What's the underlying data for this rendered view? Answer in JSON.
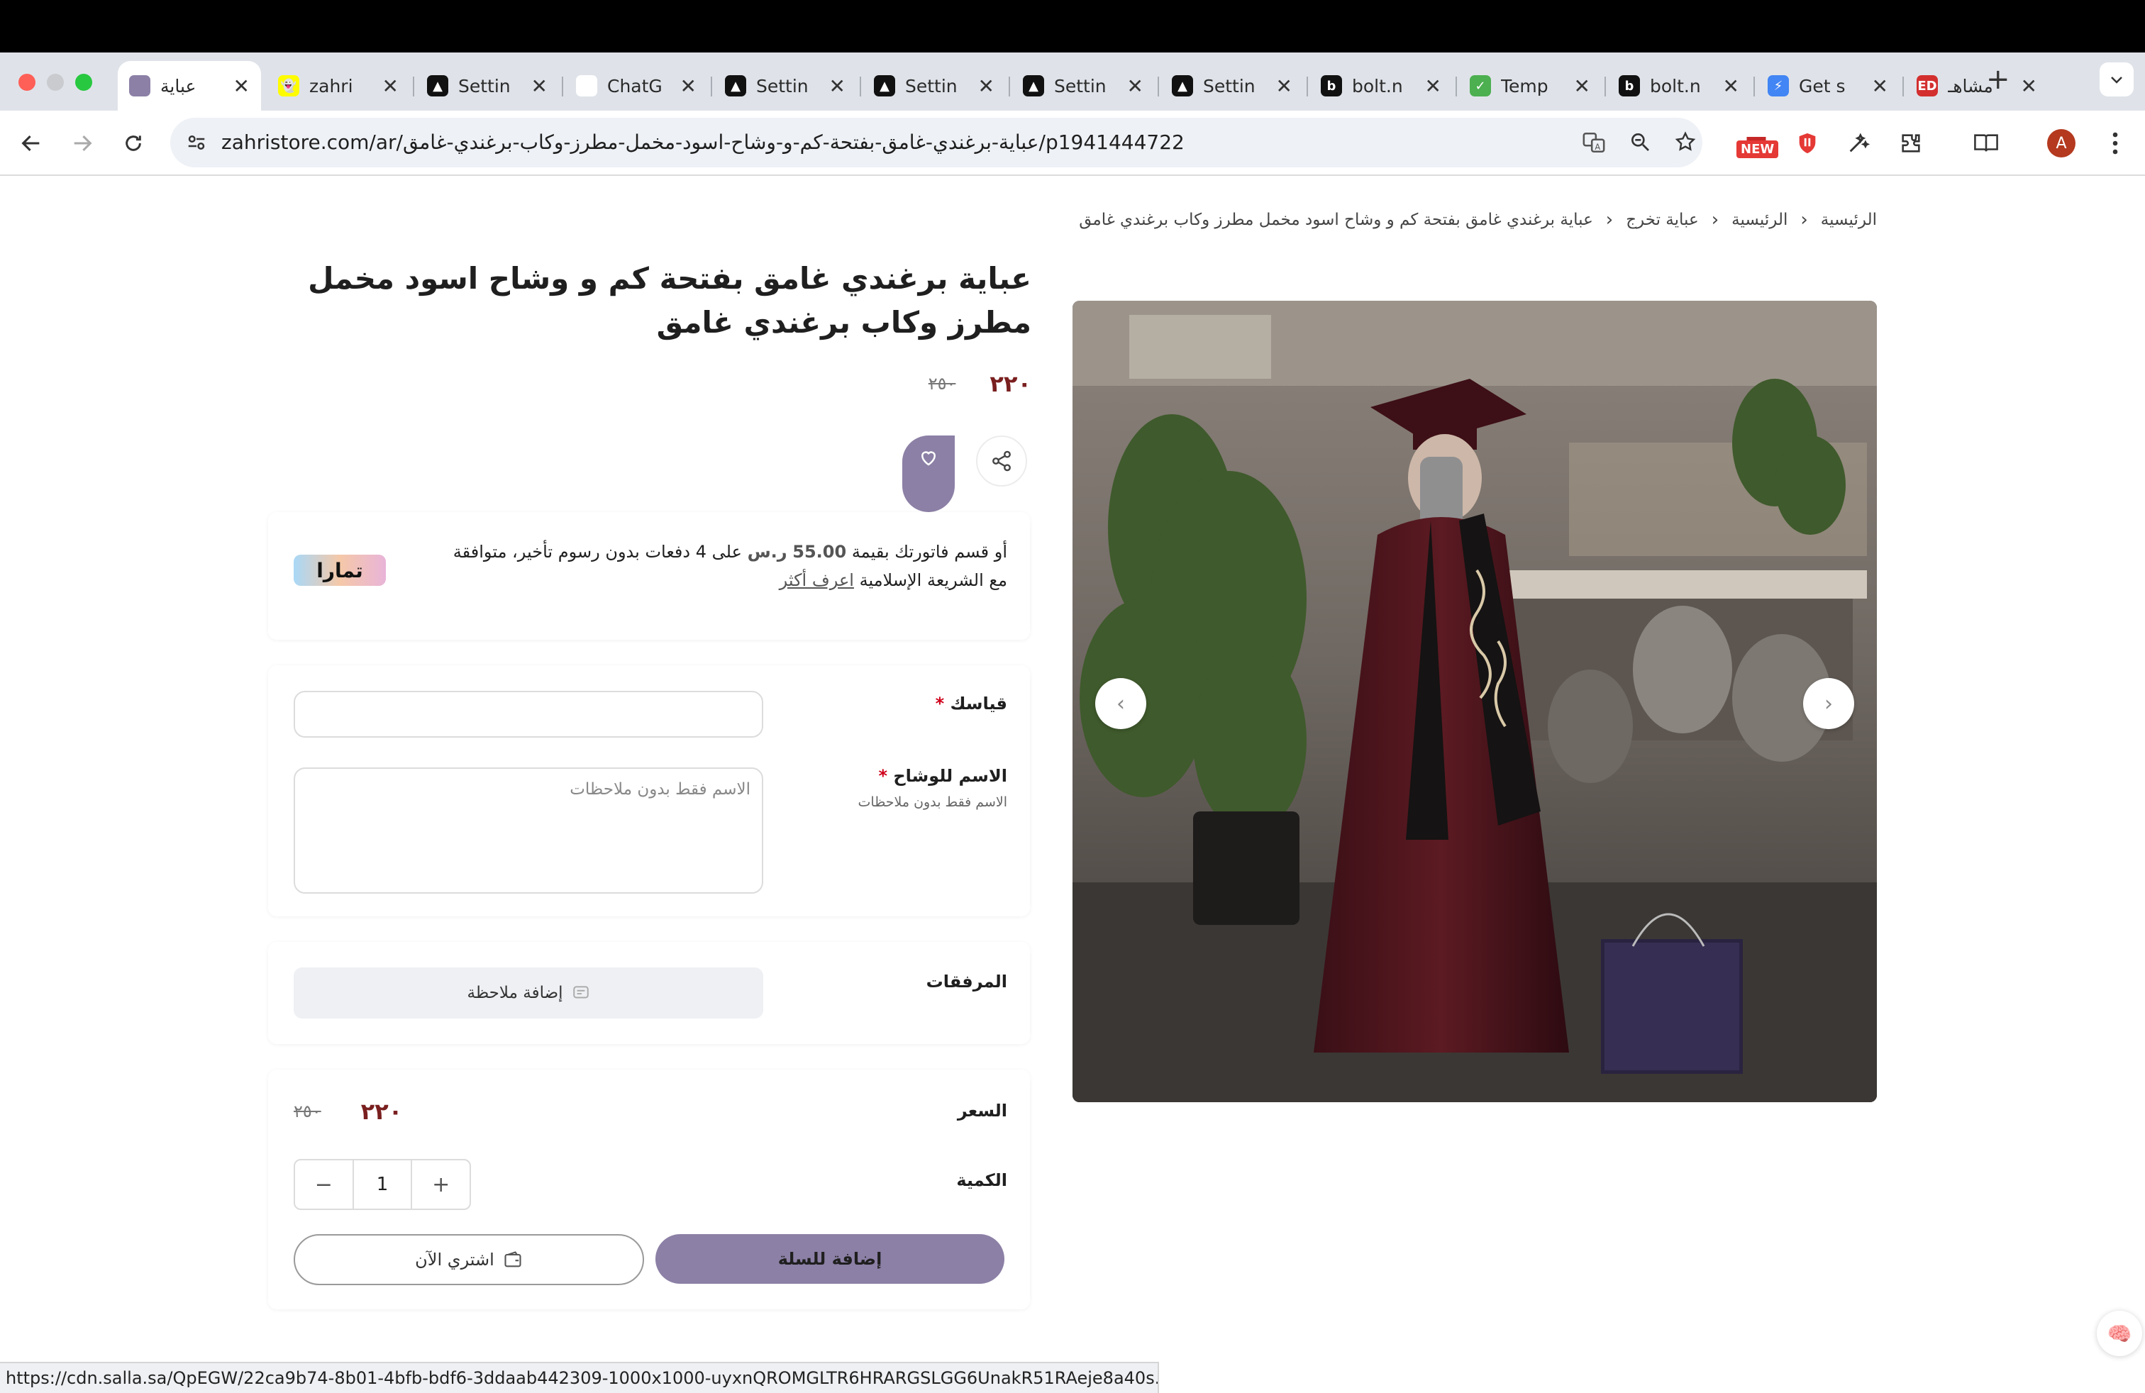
{
  "browser": {
    "tabs": [
      {
        "title": "عباية",
        "favicon_color": "#8c80a6",
        "favicon_glyph": "",
        "active": true
      },
      {
        "title": "zahri",
        "favicon_color": "#fffc00",
        "favicon_glyph": "👻"
      },
      {
        "title": "Settin",
        "favicon_color": "#111111",
        "favicon_glyph": "▲"
      },
      {
        "title": "ChatG",
        "favicon_color": "#ffffff",
        "favicon_glyph": "✺"
      },
      {
        "title": "Settin",
        "favicon_color": "#111111",
        "favicon_glyph": "▲"
      },
      {
        "title": "Settin",
        "favicon_color": "#111111",
        "favicon_glyph": "▲"
      },
      {
        "title": "Settin",
        "favicon_color": "#111111",
        "favicon_glyph": "▲"
      },
      {
        "title": "Settin",
        "favicon_color": "#111111",
        "favicon_glyph": "▲"
      },
      {
        "title": "bolt.n",
        "favicon_color": "#111111",
        "favicon_glyph": "b"
      },
      {
        "title": "Temp",
        "favicon_color": "#4caf50",
        "favicon_glyph": "✓"
      },
      {
        "title": "bolt.n",
        "favicon_color": "#111111",
        "favicon_glyph": "b"
      },
      {
        "title": "Get s",
        "favicon_color": "#4285f4",
        "favicon_glyph": "⚡"
      },
      {
        "title": "مشاهـ",
        "favicon_color": "#d32f2f",
        "favicon_glyph": "ED"
      }
    ],
    "url": "zahristore.com/ar/عباية-برغندي-غامق-بفتحة-كم-و-وشاح-اسود-مخمل-مطرز-وكاب-برغندي-غامق/p1941444722",
    "new_badge": "NEW",
    "profile_initial": "A",
    "status_url": "https://cdn.salla.sa/QpEGW/22ca9b74-8b01-4bfb-bdf6-3ddaab442309-1000x1000-uyxnQROMGLTR6HRARGSLGG6UnakR51RAeje8a40s.jpg"
  },
  "breadcrumb": [
    "الرئيسية",
    "الرئيسية",
    "عباية تخرج",
    "عباية برغندي غامق بفتحة كم و وشاح اسود مخمل مطرز وكاب برغندي غامق"
  ],
  "product": {
    "title": "عباية برغندي غامق بفتحة كم و وشاح اسود مخمل مطرز وكاب برغندي غامق",
    "price": "٢٢٠",
    "old_price": "٢٥٠"
  },
  "tamara": {
    "text_before": "أو قسم فاتورتك بقيمة",
    "amount": "55.00",
    "currency": "ر.س",
    "text_after": "على 4 دفعات بدون رسوم تأخير، متوافقة مع الشريعة الإسلامية",
    "learn_more": "اعرف أكثر",
    "logo_text": "تمارا"
  },
  "form": {
    "size_label": "قياسك",
    "size_value": "",
    "sash_label": "الاسم للوشاح",
    "sash_hint": "الاسم فقط بدون ملاحظات",
    "sash_placeholder": "الاسم فقط بدون ملاحظات",
    "required_mark": "*"
  },
  "attachments": {
    "label": "المرفقات",
    "add_note": "إضافة ملاحظة"
  },
  "purchase": {
    "price_label": "السعر",
    "price": "٢٢٠",
    "old_price": "٢٥٠",
    "qty_label": "الكمية",
    "qty_value": "1",
    "add_to_cart": "إضافة للسلة",
    "buy_now": "اشتري الآن"
  },
  "colors": {
    "brand": "#8c80a6",
    "price": "#7a1f1f"
  }
}
